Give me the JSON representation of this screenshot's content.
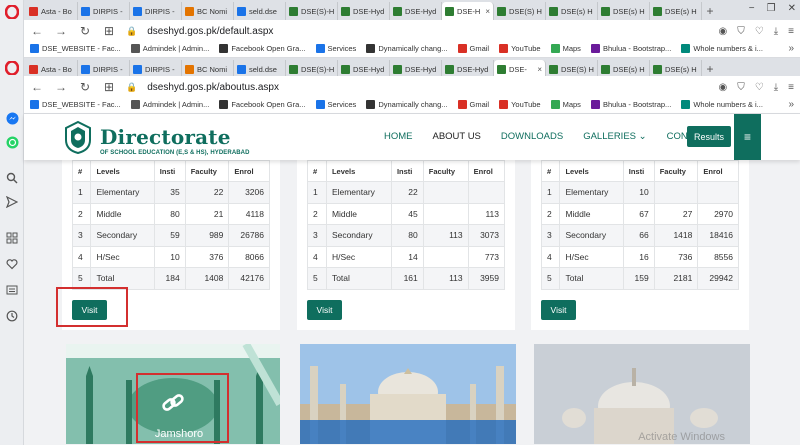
{
  "browser": {
    "tabs_top": [
      {
        "label": "Asta - Bo",
        "fav": "r"
      },
      {
        "label": "DIRPIS -",
        "fav": "b"
      },
      {
        "label": "DIRPIS -",
        "fav": "b"
      },
      {
        "label": "BC Nomi",
        "fav": "o"
      },
      {
        "label": "seld.dse",
        "fav": "b"
      },
      {
        "label": "DSE(S)-H",
        "fav": ""
      },
      {
        "label": "DSE-Hyd",
        "fav": ""
      },
      {
        "label": "DSE-Hyd",
        "fav": ""
      },
      {
        "label": "DSE-H",
        "fav": "",
        "active": true
      },
      {
        "label": "DSE(S) H",
        "fav": ""
      },
      {
        "label": "DSE(s) H",
        "fav": ""
      },
      {
        "label": "DSE(s) H",
        "fav": ""
      },
      {
        "label": "DSE(s) H",
        "fav": ""
      }
    ],
    "tabs_second": [
      {
        "label": "Asta - Bo",
        "fav": "r"
      },
      {
        "label": "DIRPIS -",
        "fav": "b"
      },
      {
        "label": "DIRPIS -",
        "fav": "b"
      },
      {
        "label": "BC Nomi",
        "fav": "o"
      },
      {
        "label": "seld.dse",
        "fav": "b"
      },
      {
        "label": "DSE(S)-H",
        "fav": ""
      },
      {
        "label": "DSE-Hyd",
        "fav": ""
      },
      {
        "label": "DSE-Hyd",
        "fav": ""
      },
      {
        "label": "DSE-Hyd",
        "fav": ""
      },
      {
        "label": "DSE-",
        "fav": "",
        "active": true
      },
      {
        "label": "DSE(S) H",
        "fav": ""
      },
      {
        "label": "DSE(s) H",
        "fav": ""
      },
      {
        "label": "DSE(s) H",
        "fav": ""
      }
    ],
    "url_top": "dseshyd.gos.pk/default.aspx",
    "url_second": "dseshyd.gos.pk/aboutus.aspx",
    "bookmarks": [
      {
        "label": "DSE_WEBSITE - Fac...",
        "color": "#1a73e8"
      },
      {
        "label": "Admindek | Admin...",
        "color": "#555555"
      },
      {
        "label": "Facebook Open Gra...",
        "color": "#333333"
      },
      {
        "label": "Services",
        "color": "#1a73e8"
      },
      {
        "label": "Dynamically chang...",
        "color": "#333333"
      },
      {
        "label": "Gmail",
        "color": "#d93025"
      },
      {
        "label": "YouTube",
        "color": "#d93025"
      },
      {
        "label": "Maps",
        "color": "#34a853"
      },
      {
        "label": "Bhulua - Bootstrap...",
        "color": "#6a1b9a"
      },
      {
        "label": "Whole numbers & i...",
        "color": "#00897b"
      }
    ],
    "bookmarks_more": "»",
    "tab_close": "×",
    "tab_add": "+",
    "window_controls": {
      "minimize": "−",
      "maximize": "❐",
      "close": "✕"
    }
  },
  "site": {
    "logo_title": "Directorate",
    "logo_subtitle": "OF SCHOOL EDUCATION (E,S & HS), HYDERABAD",
    "nav": [
      {
        "label": "HOME",
        "active": false
      },
      {
        "label": "ABOUT US",
        "active": true
      },
      {
        "label": "DOWNLOADS",
        "active": false
      },
      {
        "label": "GALLERIES ⌄",
        "active": false
      },
      {
        "label": "CONTACT",
        "active": false
      }
    ],
    "results_label": "Results",
    "menu_glyph": "≡",
    "accent": "#0f6e5e"
  },
  "tables": [
    {
      "headers": [
        "#",
        "Levels",
        "Insti",
        "Faculty",
        "Enrol"
      ],
      "rows": [
        [
          "1",
          "Elementary",
          "35",
          "22",
          "3206"
        ],
        [
          "2",
          "Middle",
          "80",
          "21",
          "4118"
        ],
        [
          "3",
          "Secondary",
          "59",
          "989",
          "26786"
        ],
        [
          "4",
          "H/Sec",
          "10",
          "376",
          "8066"
        ],
        [
          "5",
          "Total",
          "184",
          "1408",
          "42176"
        ]
      ],
      "visit_label": "Visit"
    },
    {
      "headers": [
        "#",
        "Levels",
        "Insti",
        "Faculty",
        "Enrol"
      ],
      "rows": [
        [
          "1",
          "Elementary",
          "22",
          "",
          ""
        ],
        [
          "2",
          "Middle",
          "45",
          "",
          "113"
        ],
        [
          "3",
          "Secondary",
          "80",
          "113",
          "3073"
        ],
        [
          "4",
          "H/Sec",
          "14",
          "",
          "773"
        ],
        [
          "5",
          "Total",
          "161",
          "113",
          "3959"
        ]
      ],
      "visit_label": "Visit"
    },
    {
      "headers": [
        "#",
        "Levels",
        "Insti",
        "Faculty",
        "Enrol"
      ],
      "rows": [
        [
          "1",
          "Elementary",
          "10",
          "",
          ""
        ],
        [
          "2",
          "Middle",
          "67",
          "27",
          "2970"
        ],
        [
          "3",
          "Secondary",
          "66",
          "1418",
          "18416"
        ],
        [
          "4",
          "H/Sec",
          "16",
          "736",
          "8556"
        ],
        [
          "5",
          "Total",
          "159",
          "2181",
          "29942"
        ]
      ],
      "visit_label": "Visit"
    }
  ],
  "cards": [
    {
      "caption": "Jamshoro",
      "link_icon": "link-icon"
    },
    {
      "caption": "",
      "image": "shrine-photo"
    },
    {
      "caption": "",
      "image": "dome-photo"
    }
  ],
  "watermark": "Activate Windows"
}
